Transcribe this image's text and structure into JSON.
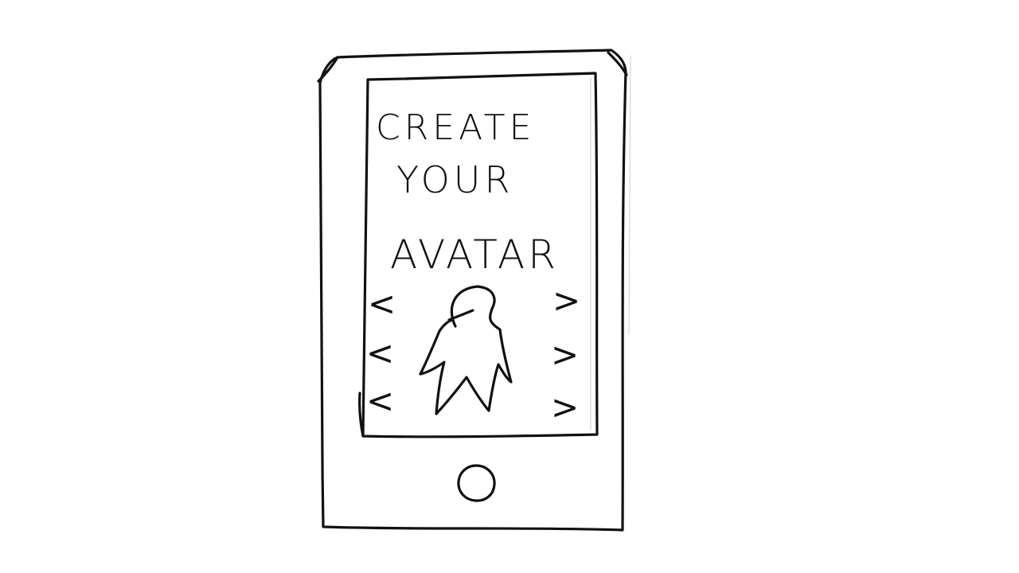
{
  "screen": {
    "title_lines": [
      "CREATE",
      "YOUR",
      "AVATAR"
    ]
  },
  "avatar_editor": {
    "left_arrows": [
      "<",
      "<",
      "<"
    ],
    "right_arrows": [
      ">",
      ">",
      ">"
    ],
    "avatar_icon": "person-silhouette-icon"
  },
  "device": {
    "home_button_icon": "home-button-icon"
  },
  "colors": {
    "ink": "#111111",
    "paper": "#ffffff"
  }
}
